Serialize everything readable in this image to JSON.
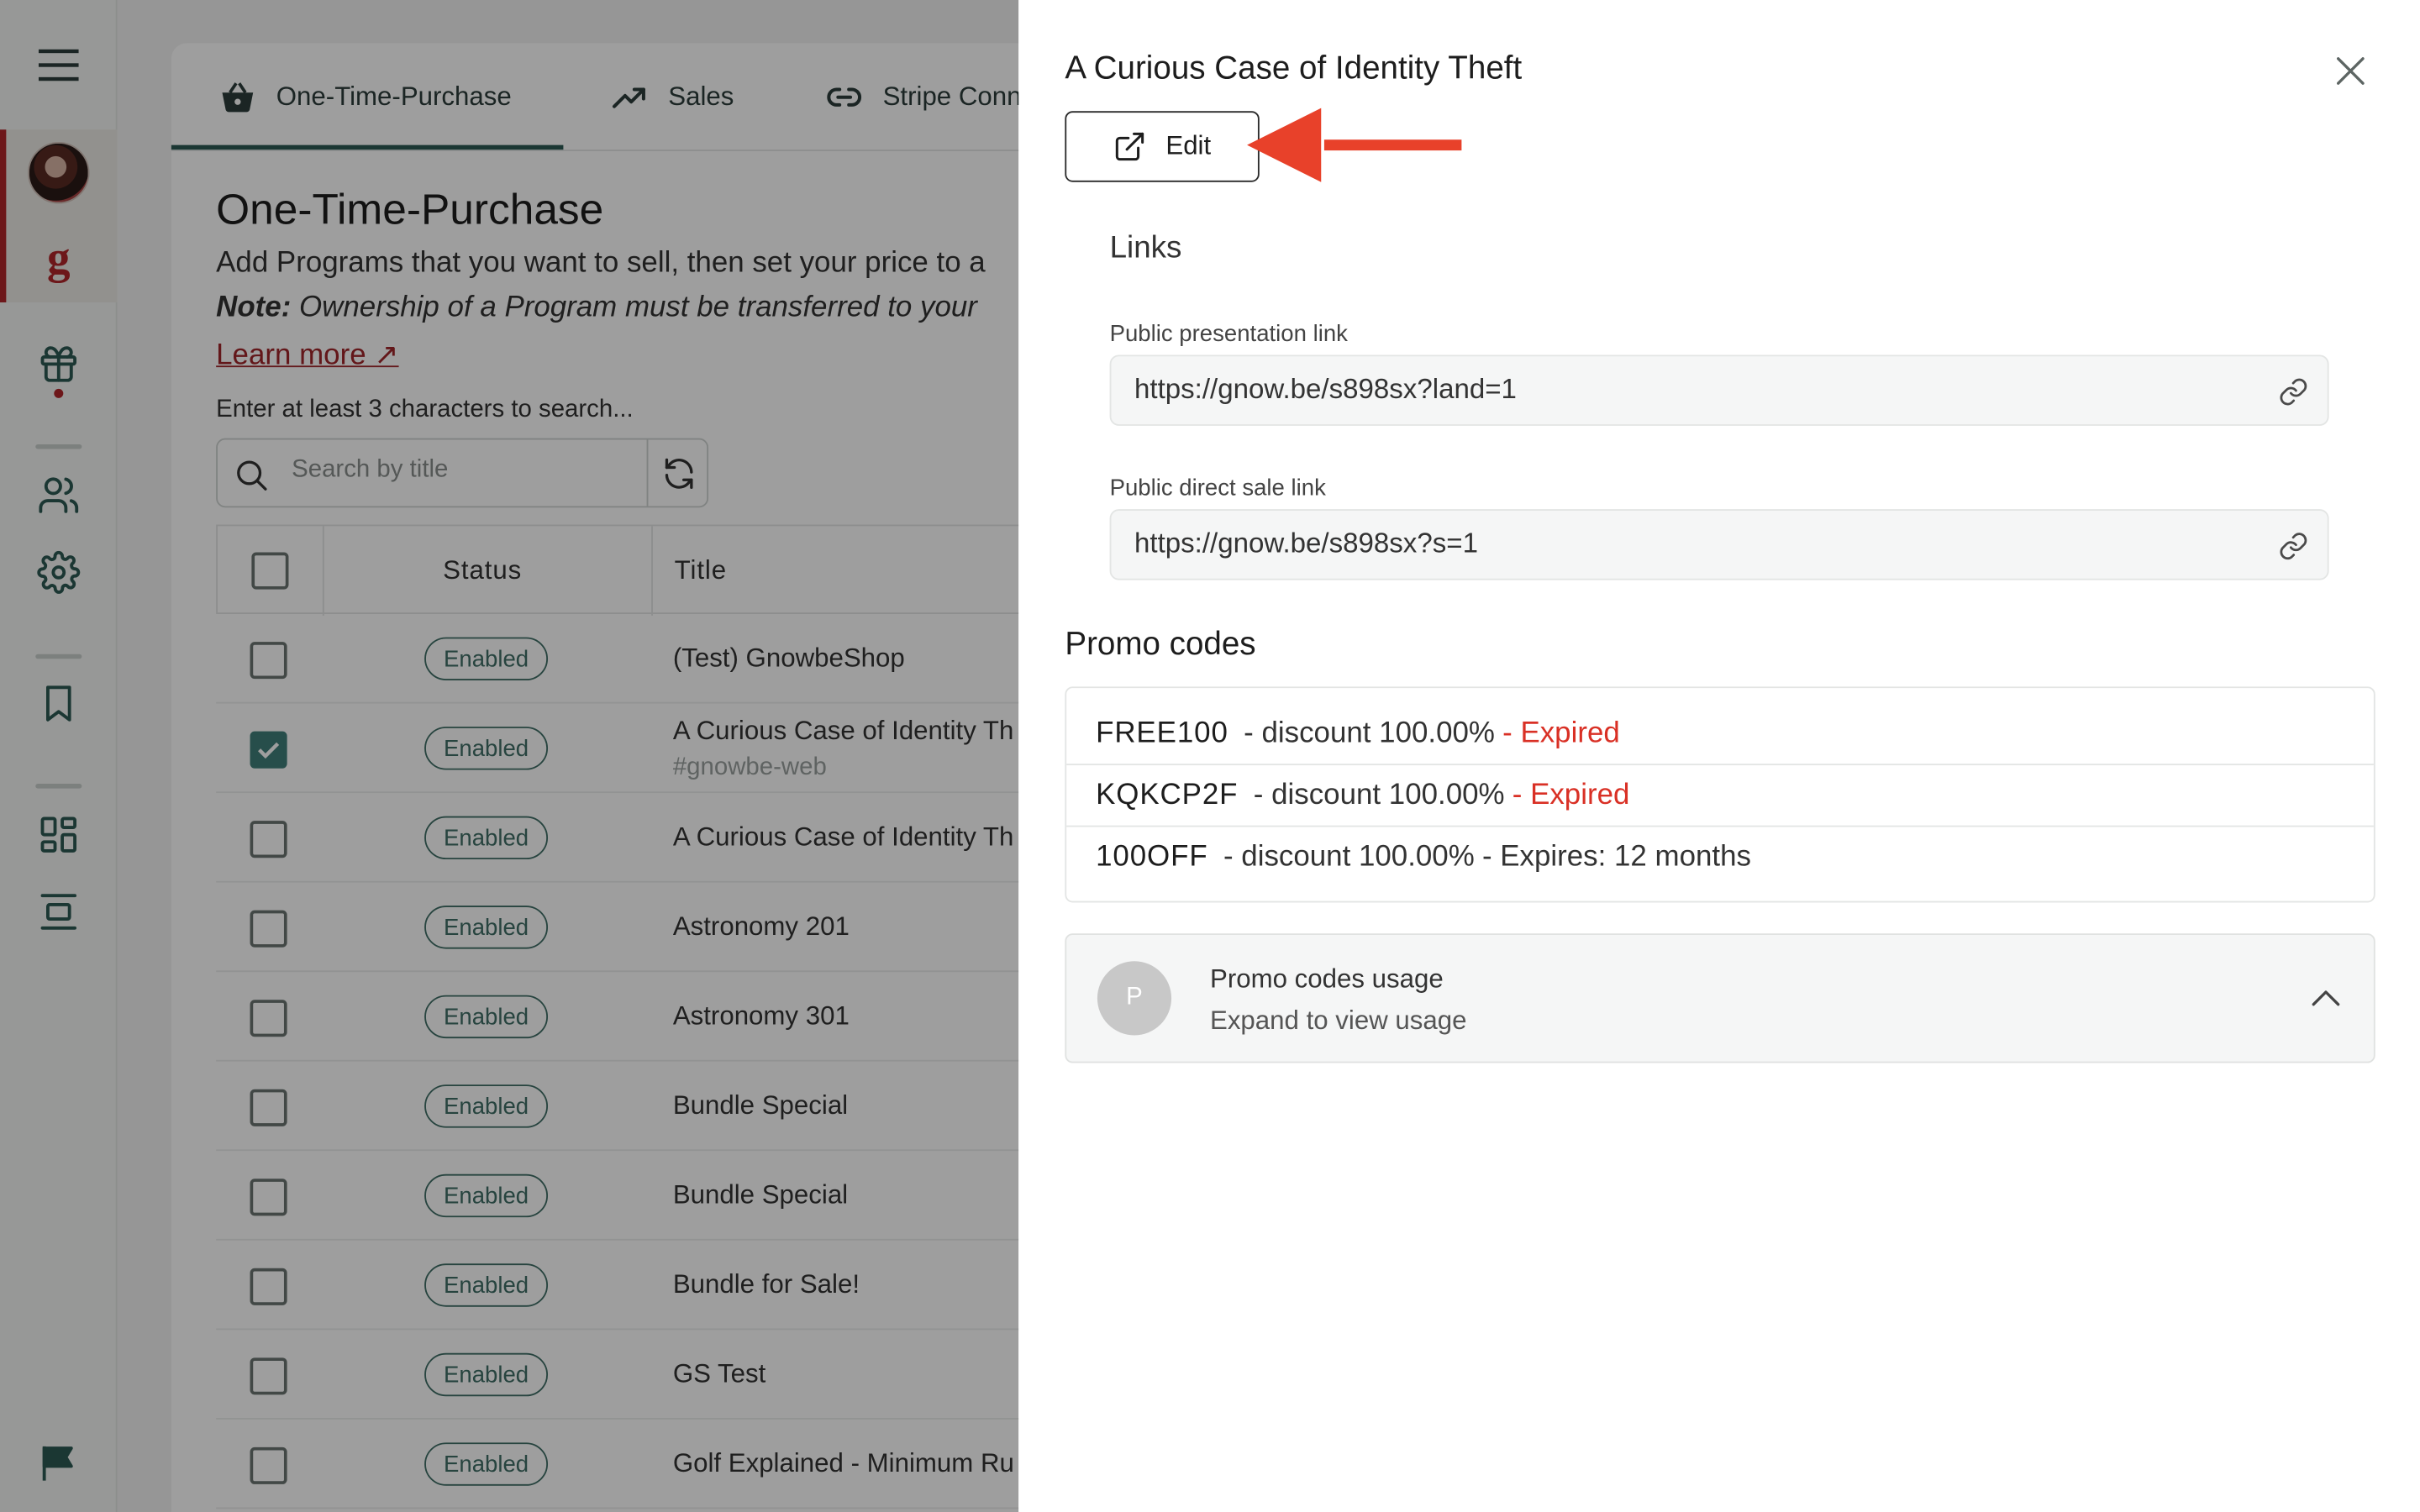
{
  "sidebar": {
    "menu_icon": "hamburger-menu-icon",
    "logo_letter": "g",
    "items": [
      "gift-icon",
      "users-icon",
      "settings-gear-icon",
      "bookmark-icon",
      "dashboard-grid-icon",
      "layout-icon",
      "flag-icon"
    ]
  },
  "tabs": [
    {
      "label": "One-Time-Purchase",
      "icon": "basket-icon"
    },
    {
      "label": "Sales",
      "icon": "trending-up-icon"
    },
    {
      "label": "Stripe Conn",
      "icon": "link-icon"
    }
  ],
  "page": {
    "title": "One-Time-Purchase",
    "description": "Add Programs that you want to sell, then set your price to a",
    "note_label": "Note:",
    "note_text": " Ownership of a Program must be transferred to your",
    "learn_more": "Learn more ↗",
    "search_hint": "Enter at least 3 characters to search...",
    "search_placeholder": "Search by title"
  },
  "table": {
    "columns": [
      "Status",
      "Title"
    ],
    "rows": [
      {
        "checked": false,
        "status": "Enabled",
        "title": "(Test) GnowbeShop",
        "subtitle": ""
      },
      {
        "checked": true,
        "status": "Enabled",
        "title": "A Curious Case of Identity Th",
        "subtitle": "#gnowbe-web"
      },
      {
        "checked": false,
        "status": "Enabled",
        "title": "A Curious Case of Identity Th",
        "subtitle": ""
      },
      {
        "checked": false,
        "status": "Enabled",
        "title": "Astronomy 201",
        "subtitle": ""
      },
      {
        "checked": false,
        "status": "Enabled",
        "title": "Astronomy 301",
        "subtitle": ""
      },
      {
        "checked": false,
        "status": "Enabled",
        "title": "Bundle Special",
        "subtitle": ""
      },
      {
        "checked": false,
        "status": "Enabled",
        "title": "Bundle Special",
        "subtitle": ""
      },
      {
        "checked": false,
        "status": "Enabled",
        "title": "Bundle for Sale!",
        "subtitle": ""
      },
      {
        "checked": false,
        "status": "Enabled",
        "title": "GS Test",
        "subtitle": ""
      },
      {
        "checked": false,
        "status": "Enabled",
        "title": "Golf Explained - Minimum Ru",
        "subtitle": ""
      }
    ]
  },
  "drawer": {
    "title": "A Curious Case of Identity Theft",
    "edit_label": "Edit",
    "links_heading": "Links",
    "presentation_label": "Public presentation link",
    "presentation_url": "https://gnow.be/s898sx?land=1",
    "direct_sale_label": "Public direct sale link",
    "direct_sale_url": "https://gnow.be/s898sx?s=1",
    "promo_heading": "Promo codes",
    "promo_codes": [
      {
        "code": "FREE100",
        "discount": "- discount  100.00%",
        "status": "- Expired",
        "expired": true
      },
      {
        "code": "KQKCP2F",
        "discount": "- discount  100.00%",
        "status": "- Expired",
        "expired": true
      },
      {
        "code": "100OFF",
        "discount": "- discount  100.00%",
        "status": "- Expires: 12 months",
        "expired": false
      }
    ],
    "usage": {
      "avatar_letter": "P",
      "title": "Promo codes usage",
      "subtitle": "Expand to view usage"
    }
  },
  "colors": {
    "accent": "#b0262a",
    "teal": "#3f6e66",
    "expired": "#d93025",
    "annotation_arrow": "#e8412a"
  }
}
